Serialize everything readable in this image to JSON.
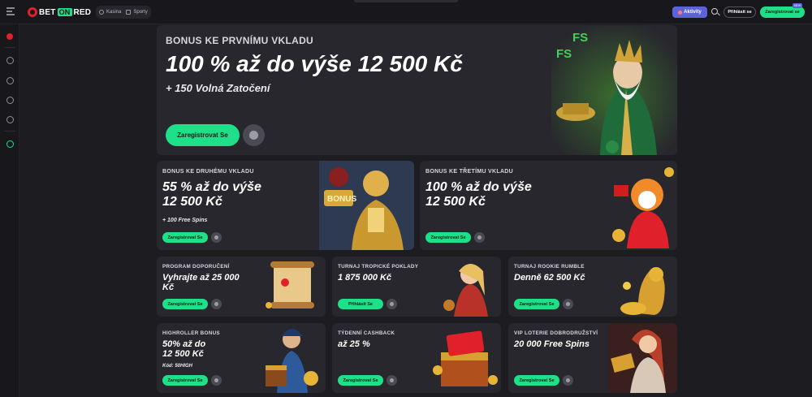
{
  "header": {
    "logo_text_left": "BET",
    "logo_text_mid": "ON",
    "logo_text_right": "RED",
    "nav": [
      {
        "label": "Kasina",
        "icon": "casino-icon"
      },
      {
        "label": "Sporty",
        "icon": "sports-icon"
      }
    ],
    "activity_label": "Aktivity",
    "login_label": "Přihlásit se",
    "register_label": "Zaregistrovat se",
    "register_badge": "NEW"
  },
  "sidebar": {
    "icons": [
      "promo-icon",
      "roulette-icon",
      "live-icon",
      "football-icon",
      "tennis-icon",
      "support-icon"
    ]
  },
  "colors": {
    "accent": "#1ee089",
    "brand_red": "#e0202a",
    "activity": "#5c63d8",
    "card": "#27272d",
    "background": "#1c1c21"
  },
  "hero": {
    "kicker": "BONUS KE PRVNÍMU VKLADU",
    "headline": "100 % až do výše 12 500 Kč",
    "sub": "+ 150 Volná Zatočení",
    "cta": "Zaregistrovat Se"
  },
  "cards": {
    "second": {
      "kicker": "BONUS KE DRUHÉMU VKLADU",
      "headline_1": "55 % až do výše",
      "headline_2": "12 500 Kč",
      "sub": "+ 100 Free Spins",
      "cta": "Zaregistrovat Se"
    },
    "third": {
      "kicker": "BONUS KE TŘETÍMU VKLADU",
      "headline_1": "100 % až do výše",
      "headline_2": "12 500 Kč",
      "cta": "Zaregistrovat Se"
    },
    "referral": {
      "kicker": "PROGRAM DOPORUČENÍ",
      "headline_1": "Vyhrajte až 25 000",
      "headline_2": "Kč",
      "cta": "Zaregistrovat Se"
    },
    "tropical": {
      "kicker": "TURNAJ TROPICKÉ POKLADY",
      "headline_1": "1 875 000 Kč",
      "cta": "Přihlásit Se"
    },
    "rookie": {
      "kicker": "TURNAJ ROOKIE RUMBLE",
      "headline_1": "Denně 62 500 Kč",
      "cta": "Zaregistrovat Se"
    },
    "highroller": {
      "kicker": "HIGHROLLER BONUS",
      "headline_1": "50% až do",
      "headline_2": "12 500 Kč",
      "sub": "Kód: 50HIGH",
      "cta": "Zaregistrovat Se"
    },
    "cashback": {
      "kicker": "TÝDENNÍ CASHBACK",
      "headline_1": "až 25 %",
      "cta": "Zaregistrovat Se"
    },
    "vip": {
      "kicker": "VIP LOTERIE DOBRODRUŽSTVÍ",
      "headline_1": "20 000 Free Spins",
      "cta": "Zaregistrovat Se"
    }
  }
}
